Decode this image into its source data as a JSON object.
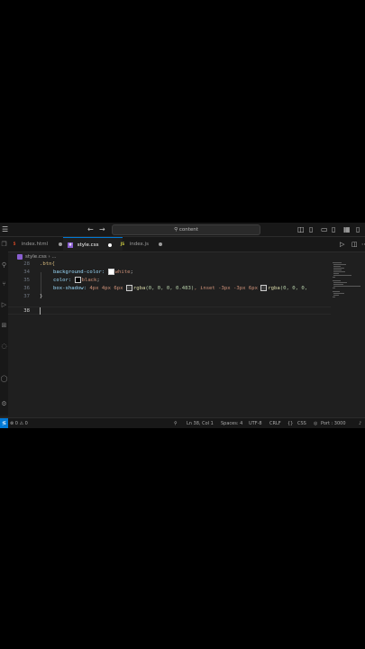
{
  "titlebar": {
    "search_text": "content"
  },
  "tabs": [
    {
      "label": "index.html",
      "icon_text": "5",
      "icon_color": "#e44d26",
      "active": false
    },
    {
      "label": "style.css",
      "icon_text": "#",
      "icon_color": "#8a5fd1",
      "active": true
    },
    {
      "label": "index.js",
      "icon_text": "JS",
      "icon_color": "#cbcb41",
      "active": false
    }
  ],
  "breadcrumb": {
    "file": "style.css",
    "separator": "›",
    "rest": "..."
  },
  "editor": {
    "lines": [
      {
        "num": "28",
        "html_key": "l28"
      },
      {
        "num": "34",
        "html_key": "l34"
      },
      {
        "num": "35",
        "html_key": "l35"
      },
      {
        "num": "36",
        "html_key": "l36"
      },
      {
        "num": "37",
        "html_key": "l37"
      },
      {
        "num": "38",
        "html_key": "l38"
      }
    ],
    "code": {
      "l28_sel": ".btn{",
      "l34_prop": "background-color: ",
      "l34_val": "white",
      "l34_end": ";",
      "l35_prop": "color: ",
      "l35_val": "black",
      "l35_end": ";",
      "l36_prop": "box-shadow: ",
      "l36_v1": "4px 4px 6px ",
      "l36_fn1": "rgba",
      "l36_args1": "(0, 0, 0, 0.483)",
      "l36_mid": ", inset -3px -3px 6px ",
      "l36_fn2": "rgba",
      "l36_args2": "(0, 0, 0,",
      "l37": "}",
      "l38": ""
    }
  },
  "statusbar": {
    "errors": "0",
    "warnings": "0",
    "position": "Ln 38, Col 1",
    "spaces": "Spaces: 4",
    "encoding": "UTF-8",
    "eol": "CRLF",
    "language": "CSS",
    "port": "Port : 3000"
  },
  "icons": {
    "menu": "hamburger-icon",
    "back": "arrow-left-icon",
    "forward": "arrow-right-icon",
    "search": "search-icon",
    "run": "play-icon",
    "split": "split-editor-icon",
    "more": "more-icon"
  },
  "colors": {
    "accent": "#0078d4",
    "html_icon": "#e44d26",
    "css_icon": "#8a5fd1",
    "js_icon": "#cbcb41"
  }
}
